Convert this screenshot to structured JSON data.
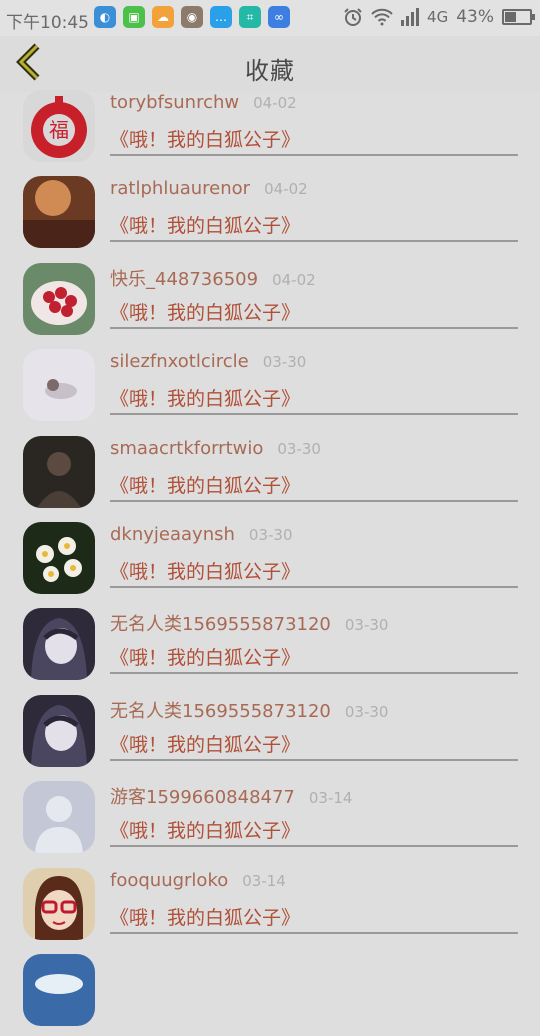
{
  "status_bar": {
    "time": "下午10:45",
    "network": "4G",
    "battery": "43%",
    "battery_level": 0.43,
    "app_icons": [
      {
        "icon": "browser-icon",
        "color": "#3b8fd6"
      },
      {
        "icon": "android-market-icon",
        "color": "#4cc04a"
      },
      {
        "icon": "weather-icon",
        "color": "#f1a23a"
      },
      {
        "icon": "eye-app-icon",
        "color": "#8c7a6a"
      },
      {
        "icon": "chat-icon",
        "color": "#2aa0e8"
      },
      {
        "icon": "scanner-icon",
        "color": "#24b8a6"
      },
      {
        "icon": "messenger-icon",
        "color": "#3c7fe0"
      }
    ]
  },
  "header": {
    "title": "收藏"
  },
  "favorites": [
    {
      "name": "torybfsunrchw",
      "date": "04-02",
      "title": "《哦！我的白狐公子》",
      "avatar": "paper-cut-apple"
    },
    {
      "name": "ratlphluaurenor",
      "date": "04-02",
      "title": "《哦！我的白狐公子》",
      "avatar": "warm-light"
    },
    {
      "name": "快乐_448736509",
      "date": "04-02",
      "title": "《哦！我的白狐公子》",
      "avatar": "rose-bouquet"
    },
    {
      "name": "silezfnxotlcircle",
      "date": "03-30",
      "title": "《哦！我的白狐公子》",
      "avatar": "white-room"
    },
    {
      "name": "smaacrtkforrtwio",
      "date": "03-30",
      "title": "《哦！我的白狐公子》",
      "avatar": "dark-portrait"
    },
    {
      "name": "dknyjeaaynsh",
      "date": "03-30",
      "title": "《哦！我的白狐公子》",
      "avatar": "narcissus"
    },
    {
      "name": "无名人类1569555873120",
      "date": "03-30",
      "title": "《哦！我的白狐公子》",
      "avatar": "anime-girl"
    },
    {
      "name": "无名人类1569555873120",
      "date": "03-30",
      "title": "《哦！我的白狐公子》",
      "avatar": "anime-girl"
    },
    {
      "name": "游客1599660848477",
      "date": "03-14",
      "title": "《哦！我的白狐公子》",
      "avatar": "default-user"
    },
    {
      "name": "fooquugrloko",
      "date": "03-14",
      "title": "《哦！我的白狐公子》",
      "avatar": "cartoon-glasses"
    },
    {
      "name": "",
      "date": "",
      "title": "",
      "avatar": "blue-sky"
    }
  ],
  "colors": {
    "name": "#a86a54",
    "title": "#b05038",
    "date": "#b0b0b0",
    "header_bg": "#dcdcdc",
    "list_bg": "#dedede"
  }
}
